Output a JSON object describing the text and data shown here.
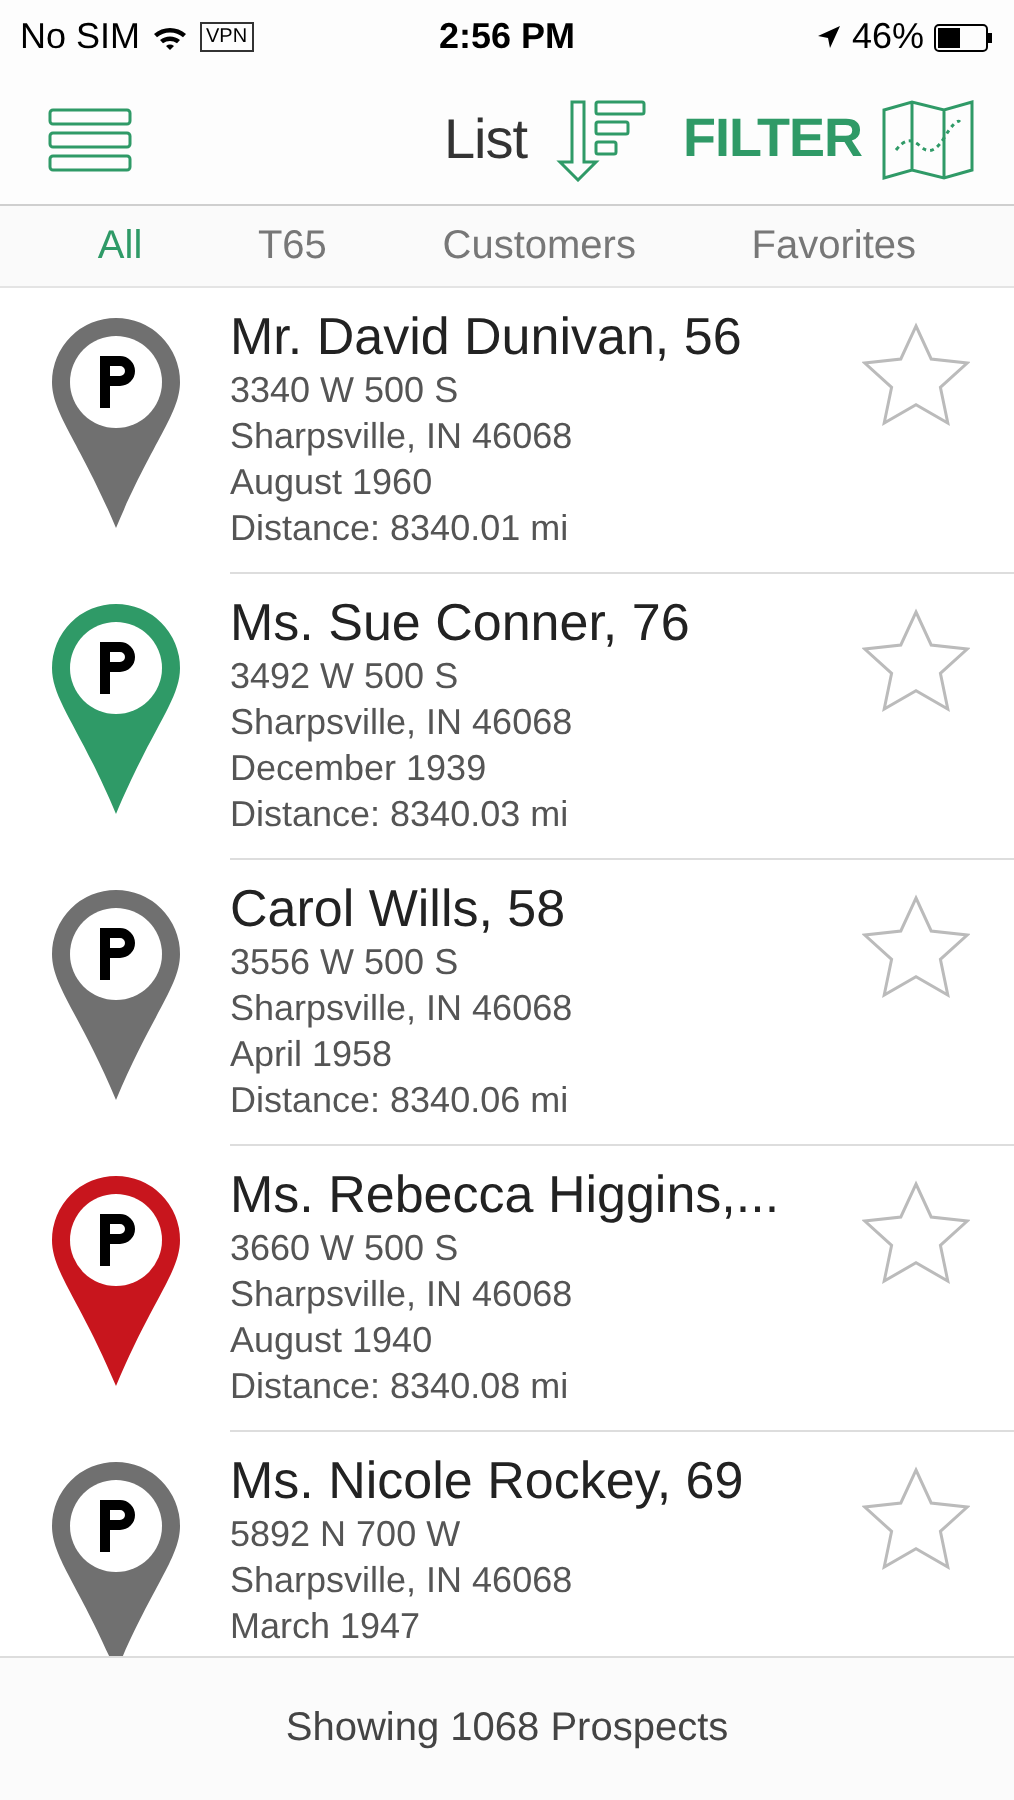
{
  "status_bar": {
    "carrier": "No SIM",
    "vpn": "VPN",
    "time": "2:56 PM",
    "battery": "46%"
  },
  "nav_bar": {
    "title": "List",
    "filter": "FILTER"
  },
  "tabs": [
    {
      "label": "All",
      "selected": true
    },
    {
      "label": "T65",
      "selected": false
    },
    {
      "label": "Customers",
      "selected": false
    },
    {
      "label": "Favorites",
      "selected": false
    }
  ],
  "prospects": [
    {
      "name": "Mr. David Dunivan, 56",
      "address": "3340 W 500 S",
      "city": "Sharpsville, IN  46068",
      "date": "August 1960",
      "distance": "Distance: 8340.01 mi",
      "color": "#707070",
      "favorite": false
    },
    {
      "name": "Ms. Sue Conner, 76",
      "address": "3492 W 500 S",
      "city": "Sharpsville, IN  46068",
      "date": "December 1939",
      "distance": "Distance: 8340.03 mi",
      "color": "#2f9a67",
      "favorite": false
    },
    {
      "name": "Carol Wills, 58",
      "address": "3556 W 500 S",
      "city": "Sharpsville, IN  46068",
      "date": "April 1958",
      "distance": "Distance: 8340.06 mi",
      "color": "#707070",
      "favorite": false
    },
    {
      "name": "Ms. Rebecca Higgins,...",
      "address": "3660 W 500 S",
      "city": "Sharpsville, IN  46068",
      "date": "August 1940",
      "distance": "Distance: 8340.08 mi",
      "color": "#c8151d",
      "favorite": false
    },
    {
      "name": "Ms. Nicole Rockey, 69",
      "address": "5892 N 700 W",
      "city": "Sharpsville, IN  46068",
      "date": "March 1947",
      "color": "#707070",
      "favorite": false
    }
  ],
  "footer": {
    "text": "Showing 1068 Prospects"
  }
}
